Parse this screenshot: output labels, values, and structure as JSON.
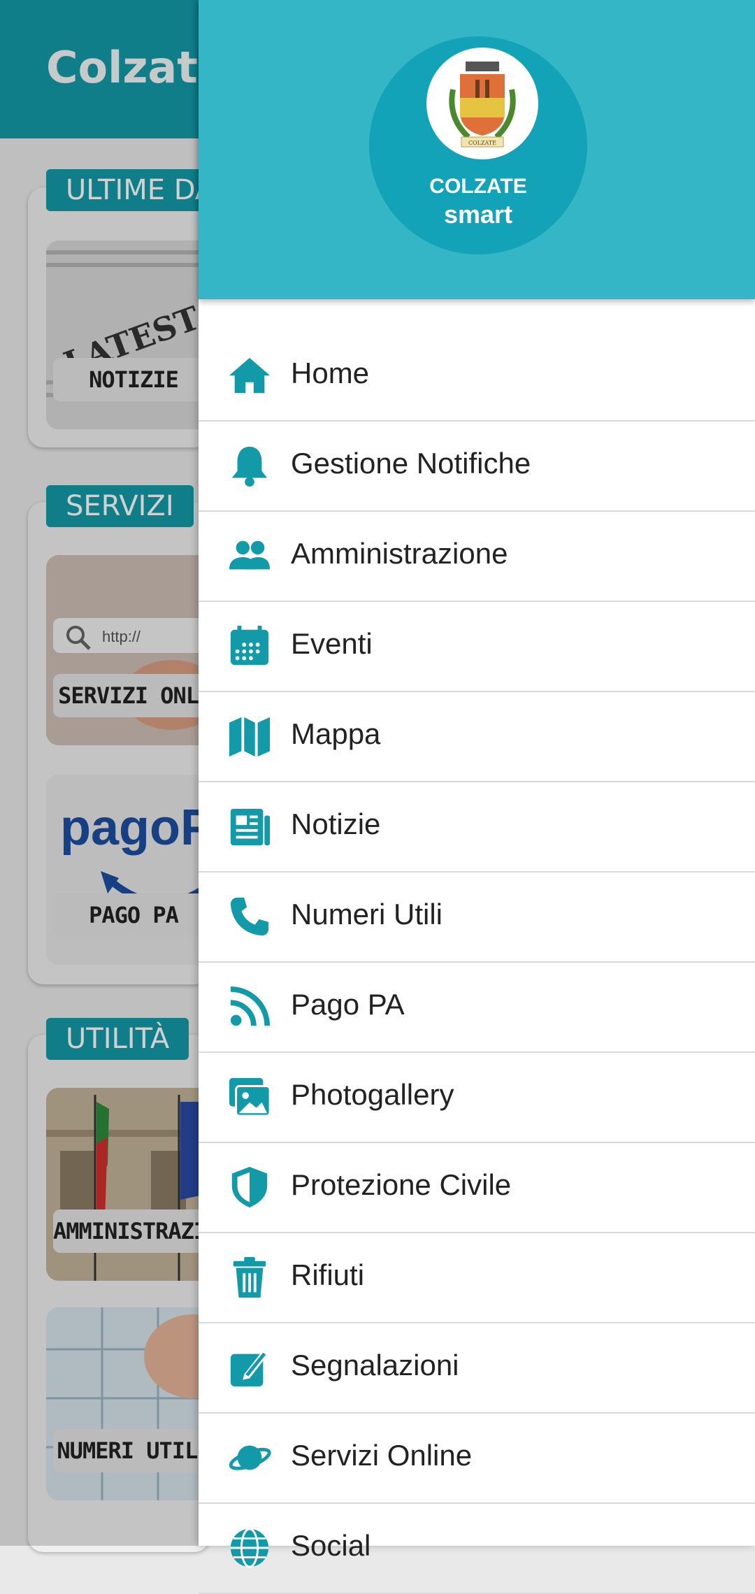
{
  "app": {
    "title": "Colzate"
  },
  "sections": [
    {
      "title": "ULTIME DA",
      "tiles": [
        "NOTIZIE"
      ]
    },
    {
      "title": "SERVIZI",
      "tiles": [
        "SERVIZI ONLINE",
        "PAGO PA"
      ]
    },
    {
      "title": "UTILITÀ",
      "tiles": [
        "AMMINISTRAZIONE",
        "NUMERI UTILI"
      ]
    }
  ],
  "tile_images": {
    "news_text": "LATEST NEWS",
    "search_text": "http://",
    "pagopa_text": "pagoPA"
  },
  "drawer": {
    "logo_line1": "COLZATE",
    "logo_line2": "smart",
    "crest_text": "COLZATE",
    "items": [
      {
        "label": "Home",
        "icon": "home-icon"
      },
      {
        "label": "Gestione Notifiche",
        "icon": "bell-icon"
      },
      {
        "label": "Amministrazione",
        "icon": "users-icon"
      },
      {
        "label": "Eventi",
        "icon": "calendar-icon"
      },
      {
        "label": "Mappa",
        "icon": "map-icon"
      },
      {
        "label": "Notizie",
        "icon": "newspaper-icon"
      },
      {
        "label": "Numeri Utili",
        "icon": "phone-icon"
      },
      {
        "label": "Pago PA",
        "icon": "rss-icon"
      },
      {
        "label": "Photogallery",
        "icon": "images-icon"
      },
      {
        "label": "Protezione Civile",
        "icon": "shield-icon"
      },
      {
        "label": "Rifiuti",
        "icon": "trash-icon"
      },
      {
        "label": "Segnalazioni",
        "icon": "edit-icon"
      },
      {
        "label": "Servizi Online",
        "icon": "planet-icon"
      },
      {
        "label": "Social",
        "icon": "globe-icon"
      }
    ]
  },
  "colors": {
    "primary": "#139aa8",
    "drawer_header": "#35b6c7",
    "logo": "#12a3b8",
    "icon": "#139aa8"
  }
}
